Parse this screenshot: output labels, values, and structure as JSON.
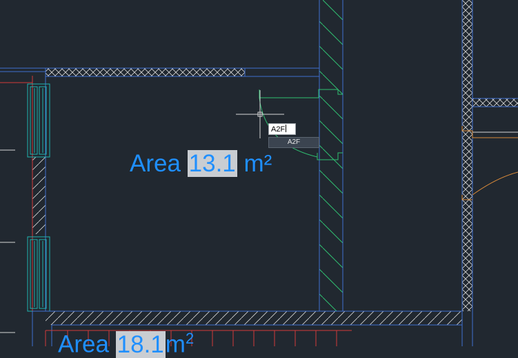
{
  "drawing": {
    "room_labels": [
      {
        "prefix": "Area ",
        "value": "13.1",
        "unit": " m²"
      },
      {
        "prefix": "Area ",
        "value": "18.1",
        "unit": "m",
        "superscript": "2"
      }
    ]
  },
  "command_line": {
    "input_value": "A2F",
    "suggestion": "A2F"
  },
  "colors": {
    "background": "#212830",
    "wall_outline": "#3f6fd0",
    "hatch": "#d8d8d8",
    "section_hatch": "#2fbf71",
    "window": "#1fb5b0",
    "door": "#2fbf71",
    "boundary_red": "#d23a3a",
    "text_blue": "#1f8fff"
  }
}
